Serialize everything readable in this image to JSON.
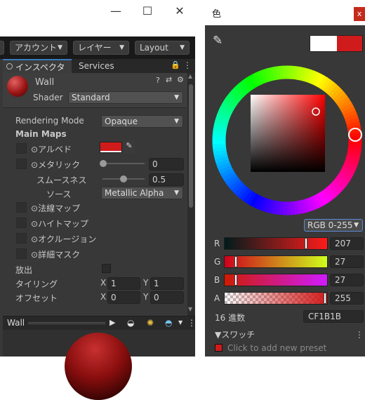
{
  "window": {
    "minimize_glyph": "—",
    "maximize_glyph": "☐",
    "close_glyph": "✕"
  },
  "toolbar": {
    "account": "アカウント",
    "layers": "レイヤー",
    "layout": "Layout"
  },
  "inspector": {
    "tab_label": "インスペクター",
    "services_tab": "Services",
    "material_name": "Wall",
    "shader_label": "Shader",
    "shader_value": "Standard",
    "rendering_mode_label": "Rendering Mode",
    "rendering_mode_value": "Opaque",
    "main_maps": "Main Maps",
    "albedo": "アルベド",
    "albedo_color": "#cf1b1b",
    "metallic": "メタリック",
    "metallic_value": "0",
    "smoothness": "スムースネス",
    "smoothness_value": "0.5",
    "source": "ソース",
    "source_value": "Metallic Alpha",
    "normal_map": "法線マップ",
    "height_map": "ハイトマップ",
    "occlusion": "オクルージョン",
    "detail_mask": "詳細マスク",
    "emission": "放出",
    "tiling": "タイリング",
    "offset": "オフセット",
    "tiling_x": "1",
    "tiling_y": "1",
    "offset_x": "0",
    "offset_y": "0",
    "x_label": "X",
    "y_label": "Y",
    "preview_title": "Wall"
  },
  "color_picker": {
    "title": "色",
    "mode": "RGB 0-255",
    "r_label": "R",
    "g_label": "G",
    "b_label": "B",
    "a_label": "A",
    "r_value": "207",
    "g_value": "27",
    "b_value": "27",
    "a_value": "255",
    "hex_label": "16 進数",
    "hex_value": "CF1B1B",
    "swatch_label": "スワッチ",
    "add_preset": "Click to add new preset",
    "current_color": "#cf1b1b"
  }
}
